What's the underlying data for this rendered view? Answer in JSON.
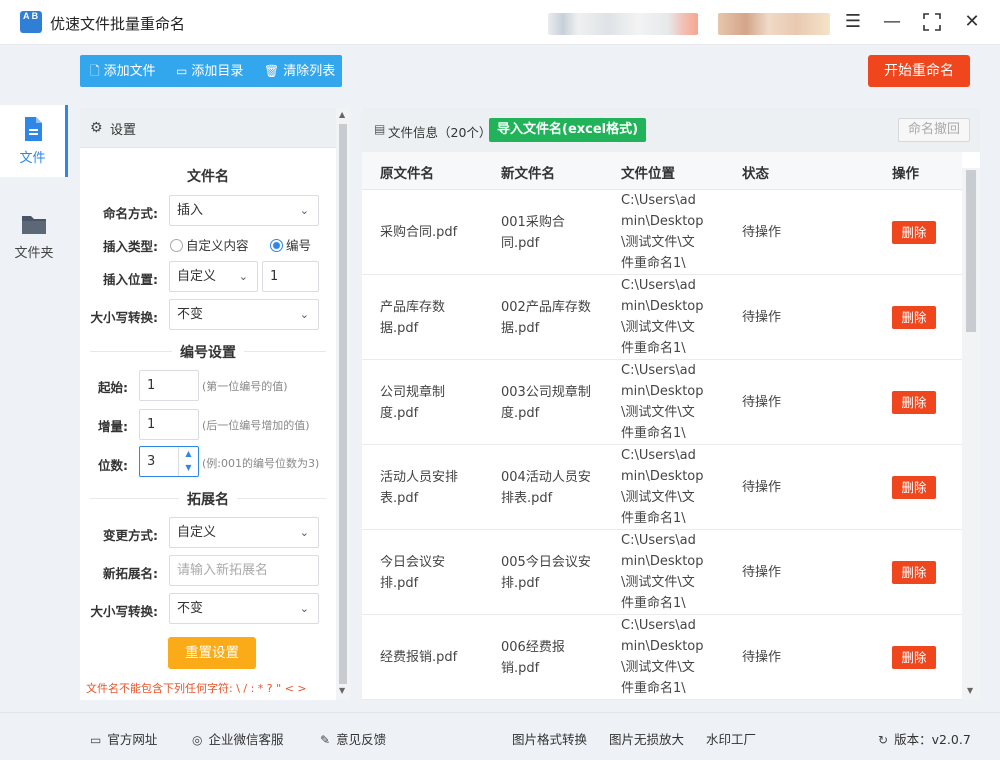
{
  "window": {
    "title": "优速文件批量重命名",
    "logo_text": "A B"
  },
  "nav": {
    "file": "文件",
    "folder": "文件夹"
  },
  "toolbar": {
    "add_file": "添加文件",
    "add_dir": "添加目录",
    "clear_list": "清除列表",
    "start_rename": "开始重命名"
  },
  "settings": {
    "title": "设置",
    "section_filename": "文件名",
    "naming_mode_label": "命名方式:",
    "naming_mode_value": "插入",
    "insert_type_label": "插入类型:",
    "insert_type_options": [
      "自定义内容",
      "编号"
    ],
    "insert_type_selected": "编号",
    "insert_pos_label": "插入位置:",
    "insert_pos_value": "自定义",
    "insert_pos_number": "1",
    "case_label": "大小写转换:",
    "case_value": "不变",
    "section_numbering": "编号设置",
    "start_label": "起始:",
    "start_value": "1",
    "start_hint": "(第一位编号的值)",
    "step_label": "增量:",
    "step_value": "1",
    "step_hint": "(后一位编号增加的值)",
    "digits_label": "位数:",
    "digits_value": "3",
    "digits_hint": "(例:001的编号位数为3)",
    "section_ext": "拓展名",
    "ext_mode_label": "变更方式:",
    "ext_mode_value": "自定义",
    "new_ext_label": "新拓展名:",
    "new_ext_placeholder": "请输入新拓展名",
    "ext_case_label": "大小写转换:",
    "ext_case_value": "不变",
    "reset": "重置设置",
    "invalid_chars_note": "文件名不能包含下列任何字符: \\ / : * ? \" < >"
  },
  "files": {
    "info_label": "文件信息（20个）",
    "import_button": "导入文件名(excel格式)",
    "undo_button": "命名撤回",
    "columns": [
      "原文件名",
      "新文件名",
      "文件位置",
      "状态",
      "操作"
    ],
    "rows": [
      {
        "orig": "采购合同.pdf",
        "new": "001采购合同.pdf",
        "path": "C:\\Users\\admin\\Desktop\\测试文件\\文件重命名1\\",
        "status": "待操作",
        "action": "删除"
      },
      {
        "orig": "产品库存数据.pdf",
        "new": "002产品库存数据.pdf",
        "path": "C:\\Users\\admin\\Desktop\\测试文件\\文件重命名1\\",
        "status": "待操作",
        "action": "删除"
      },
      {
        "orig": "公司规章制度.pdf",
        "new": "003公司规章制度.pdf",
        "path": "C:\\Users\\admin\\Desktop\\测试文件\\文件重命名1\\",
        "status": "待操作",
        "action": "删除"
      },
      {
        "orig": "活动人员安排表.pdf",
        "new": "004活动人员安排表.pdf",
        "path": "C:\\Users\\admin\\Desktop\\测试文件\\文件重命名1\\",
        "status": "待操作",
        "action": "删除"
      },
      {
        "orig": "今日会议安排.pdf",
        "new": "005今日会议安排.pdf",
        "path": "C:\\Users\\admin\\Desktop\\测试文件\\文件重命名1\\",
        "status": "待操作",
        "action": "删除"
      },
      {
        "orig": "经费报销.pdf",
        "new": "006经费报销.pdf",
        "path": "C:\\Users\\admin\\Desktop\\测试文件\\文件重命名1\\",
        "status": "待操作",
        "action": "删除"
      }
    ]
  },
  "footer": {
    "website": "官方网址",
    "wechat": "企业微信客服",
    "feedback": "意见反馈",
    "img_convert": "图片格式转换",
    "img_upscale": "图片无损放大",
    "watermark": "水印工厂",
    "version": "版本：v2.0.7"
  },
  "colors": {
    "accent": "#2e86e6",
    "toolbar": "#33a7ee",
    "danger": "#f0461e",
    "import": "#21b35a",
    "reset": "#fbab17"
  }
}
